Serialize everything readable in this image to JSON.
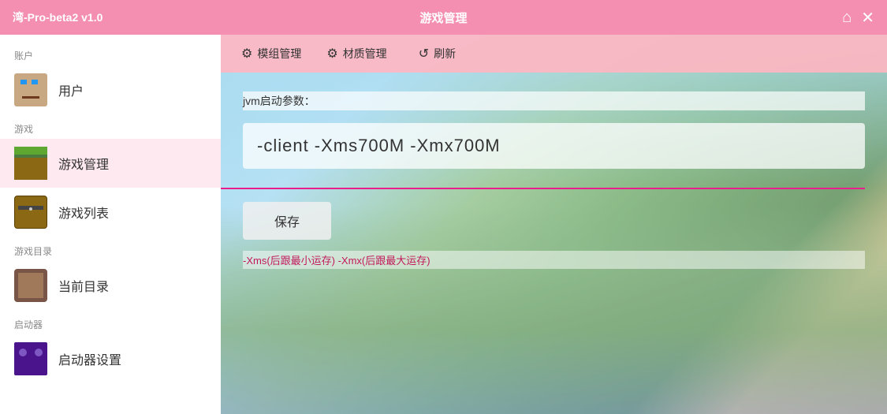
{
  "titleBar": {
    "appName": "湾-Pro-beta2 v1.0",
    "pageTitle": "游戏管理",
    "homeIcon": "⌂",
    "closeIcon": "✕"
  },
  "sidebar": {
    "sections": [
      {
        "label": "账户",
        "items": [
          {
            "id": "user",
            "icon": "steve",
            "label": "用户"
          }
        ]
      },
      {
        "label": "游戏",
        "items": [
          {
            "id": "game-manage",
            "icon": "grass",
            "label": "游戏管理"
          },
          {
            "id": "game-list",
            "icon": "chest",
            "label": "游戏列表"
          }
        ]
      },
      {
        "label": "游戏目录",
        "items": [
          {
            "id": "current-dir",
            "icon": "book",
            "label": "当前目录"
          }
        ]
      },
      {
        "label": "启动器",
        "items": [
          {
            "id": "launcher-settings",
            "icon": "furnace",
            "label": "启动器设置"
          }
        ]
      }
    ]
  },
  "tabs": [
    {
      "id": "mod-manage",
      "icon": "⚙",
      "label": "模组管理"
    },
    {
      "id": "material-manage",
      "icon": "⚙",
      "label": "材质管理"
    },
    {
      "id": "refresh",
      "icon": "↺",
      "label": "刷新"
    }
  ],
  "content": {
    "jvmLabel": "jvm启动参数：",
    "jvmValue": "-client -Xms700M -Xmx700M",
    "saveButton": "保存",
    "hintText": "-Xms(后跟最小运存) -Xmx(后跟最大运存)"
  }
}
